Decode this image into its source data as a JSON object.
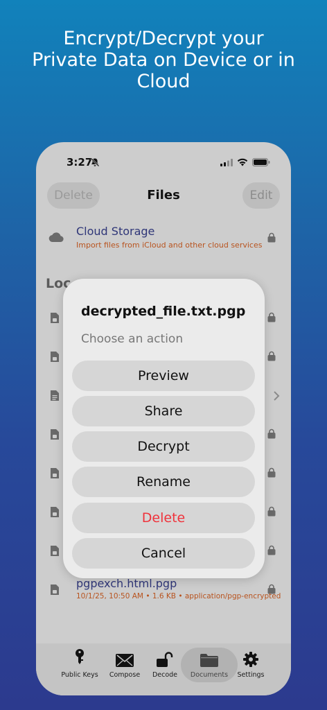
{
  "headline": [
    "Encrypt/Decrypt your",
    "Private Data on Device or in",
    "Cloud"
  ],
  "status": {
    "time": "3:27"
  },
  "nav": {
    "delete": "Delete",
    "title": "Files",
    "edit": "Edit"
  },
  "cloud": {
    "title": "Cloud Storage",
    "subtitle": "Import files from iCloud and other cloud services"
  },
  "section_header": "Loc",
  "last_file": {
    "name": "pgpexch.html.pgp",
    "meta": "10/1/25, 10:50 AM • 1.6 KB • application/pgp-encrypted"
  },
  "dialog": {
    "title": "decrypted_file.txt.pgp",
    "message": "Choose an action",
    "buttons": [
      "Preview",
      "Share",
      "Decrypt",
      "Rename",
      "Delete",
      "Cancel"
    ]
  },
  "tabs": [
    "Public Keys",
    "Compose",
    "Decode",
    "Documents",
    "Settings"
  ],
  "colors": {
    "accent": "#2f3678",
    "subtitle": "#b8531e",
    "danger": "#f0323b"
  }
}
